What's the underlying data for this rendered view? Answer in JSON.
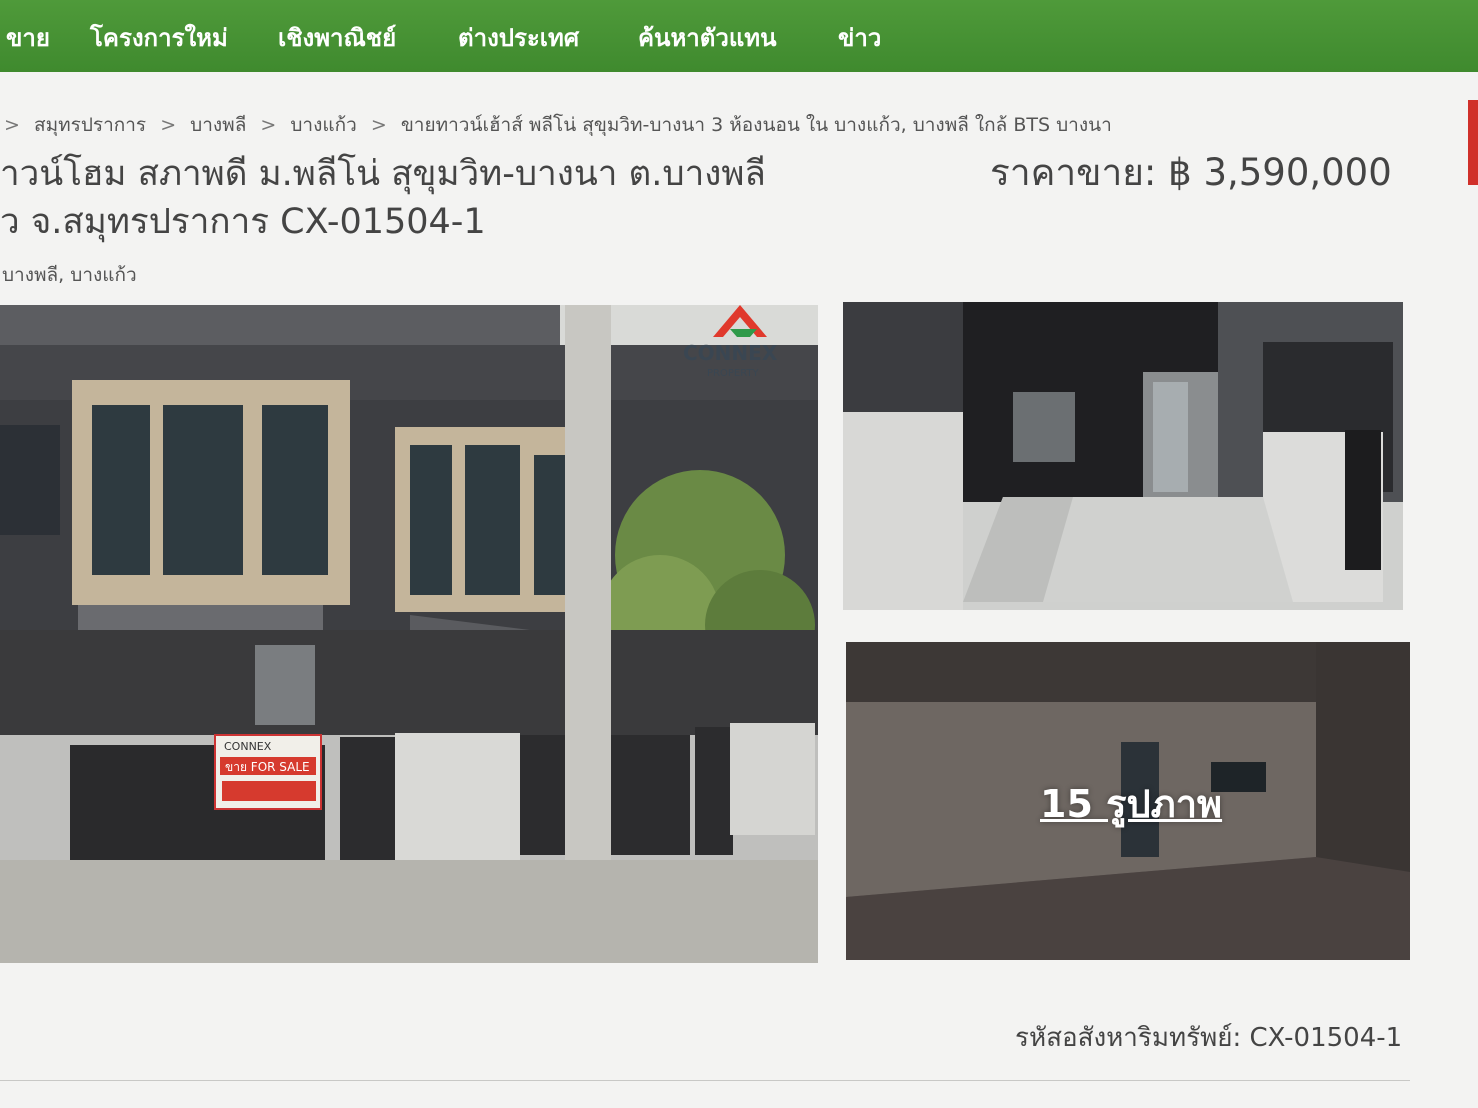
{
  "nav": {
    "items": [
      "ขาย",
      "โครงการใหม่",
      "เชิงพาณิชย์",
      "ต่างประเทศ",
      "ค้นหาตัวแทน",
      "ข่าว"
    ]
  },
  "breadcrumb": {
    "items": [
      "สมุทรปราการ",
      "บางพลี",
      "บางแก้ว",
      "ขายทาวน์เฮ้าส์ พลีโน่ สุขุมวิท-บางนา 3 ห้องนอน ใน บางแก้ว, บางพลี ใกล้ BTS บางนา"
    ],
    "separator": ">"
  },
  "listing": {
    "title_line1": "าวน์โฮม สภาพดี ม.พลีโน่ สุขุมวิท-บางนา ต.บางพลี",
    "title_line2": "ว จ.สมุทรปราการ CX-01504-1",
    "price": "ราคาขาย: ฿ 3,590,000",
    "location": "บางพลี, บางแก้ว",
    "photo_count": "15 รูปภาพ",
    "asset_code": "รหัสอสังหาริมทรัพย์: CX-01504-1"
  },
  "watermark": {
    "brand": "CONNEX",
    "sub": "PROPERTY"
  },
  "sign": {
    "brand": "CONNEX",
    "text": "ขาย FOR SALE"
  },
  "colors": {
    "nav_green": "#46922f",
    "logo_red": "#e0392c",
    "logo_green": "#2f9a4a",
    "page_bg": "#f3f3f2"
  }
}
